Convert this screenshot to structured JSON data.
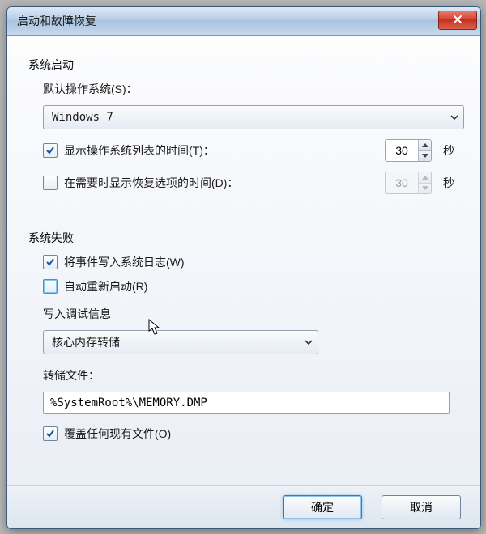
{
  "window": {
    "title": "启动和故障恢复"
  },
  "startup": {
    "section_title": "系统启动",
    "default_os_label": "默认操作系统(S)：",
    "default_os_value": "Windows 7",
    "show_os_list_label": "显示操作系统列表的时间(T)：",
    "show_os_list_value": "30",
    "show_recovery_label": "在需要时显示恢复选项的时间(D)：",
    "show_recovery_value": "30",
    "seconds_unit": "秒"
  },
  "failure": {
    "section_title": "系统失败",
    "write_event_label": "将事件写入系统日志(W)",
    "auto_restart_label": "自动重新启动(R)",
    "debug_info_label": "写入调试信息",
    "debug_combo_value": "核心内存转储",
    "dump_file_label": "转储文件：",
    "dump_file_value": "%SystemRoot%\\MEMORY.DMP",
    "overwrite_label": "覆盖任何现有文件(O)"
  },
  "buttons": {
    "ok": "确定",
    "cancel": "取消"
  }
}
